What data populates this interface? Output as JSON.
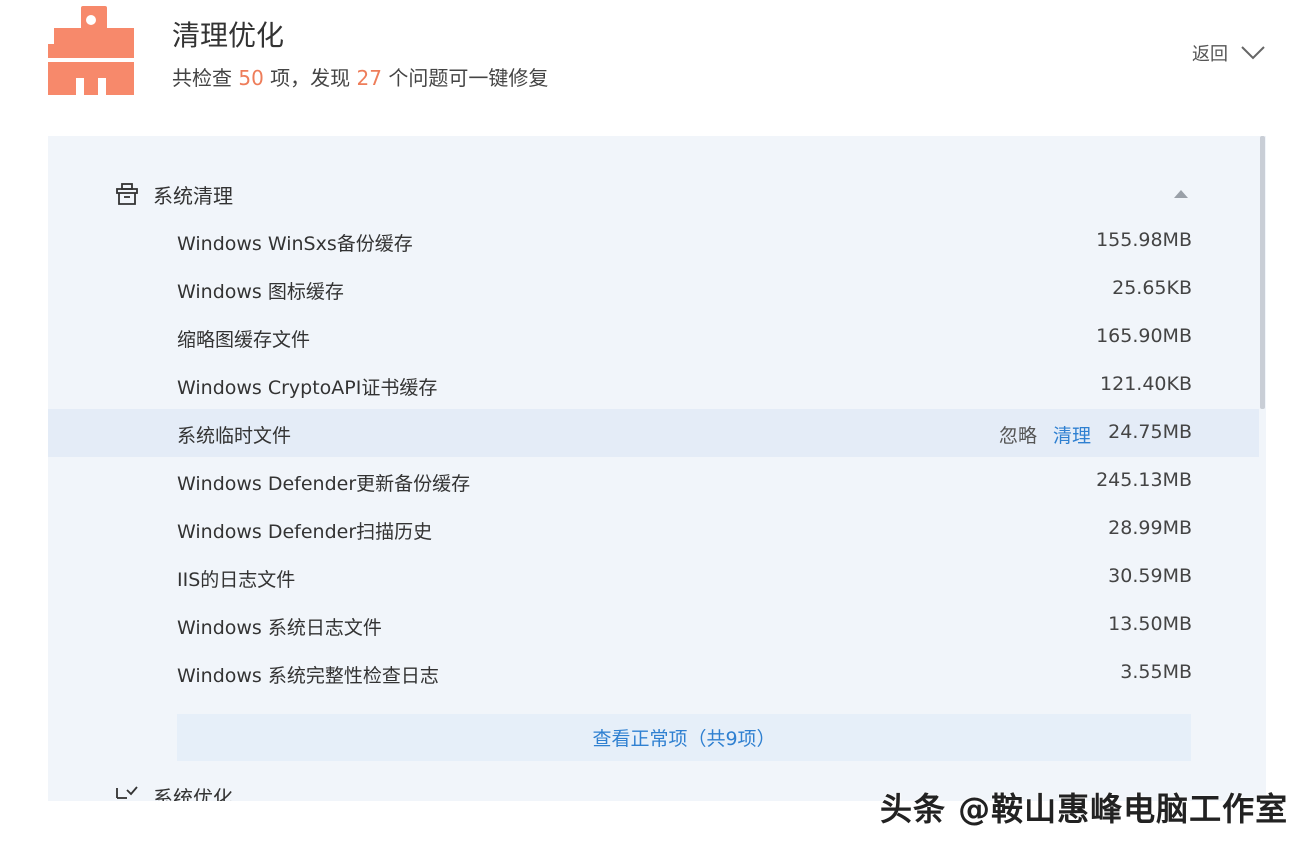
{
  "header": {
    "title": "清理优化",
    "summary_prefix": "共检查 ",
    "checked_count": "50",
    "summary_mid": " 项，发现 ",
    "issue_count": "27",
    "summary_suffix": " 个问题可一键修复",
    "back_label": "返回",
    "icon": "broom-clean-icon",
    "accent_color": "#f7896b"
  },
  "section_cleanup": {
    "title": "系统清理",
    "icon": "basket-icon",
    "items": [
      {
        "label": "Windows WinSxs备份缓存",
        "size": "155.98MB"
      },
      {
        "label": "Windows 图标缓存",
        "size": "25.65KB"
      },
      {
        "label": "缩略图缓存文件",
        "size": "165.90MB"
      },
      {
        "label": "Windows CryptoAPI证书缓存",
        "size": "121.40KB"
      },
      {
        "label": "系统临时文件",
        "size": "24.75MB",
        "ignore": "忽略",
        "clean": "清理"
      },
      {
        "label": "Windows Defender更新备份缓存",
        "size": "245.13MB"
      },
      {
        "label": "Windows Defender扫描历史",
        "size": "28.99MB"
      },
      {
        "label": "IIS的日志文件",
        "size": "30.59MB"
      },
      {
        "label": "Windows 系统日志文件",
        "size": "13.50MB"
      },
      {
        "label": "Windows 系统完整性检查日志",
        "size": "3.55MB"
      }
    ],
    "view_normal": "查看正常项（共9项）"
  },
  "section_optimize": {
    "title": "系统优化",
    "icon": "checklist-icon"
  },
  "watermark": "头条 @鞍山惠峰电脑工作室",
  "colors": {
    "link": "#2f80d1",
    "panel_bg": "#f1f5fa",
    "hover_row": "#e4ecf7",
    "highlight_number": "#ee7d5a"
  }
}
